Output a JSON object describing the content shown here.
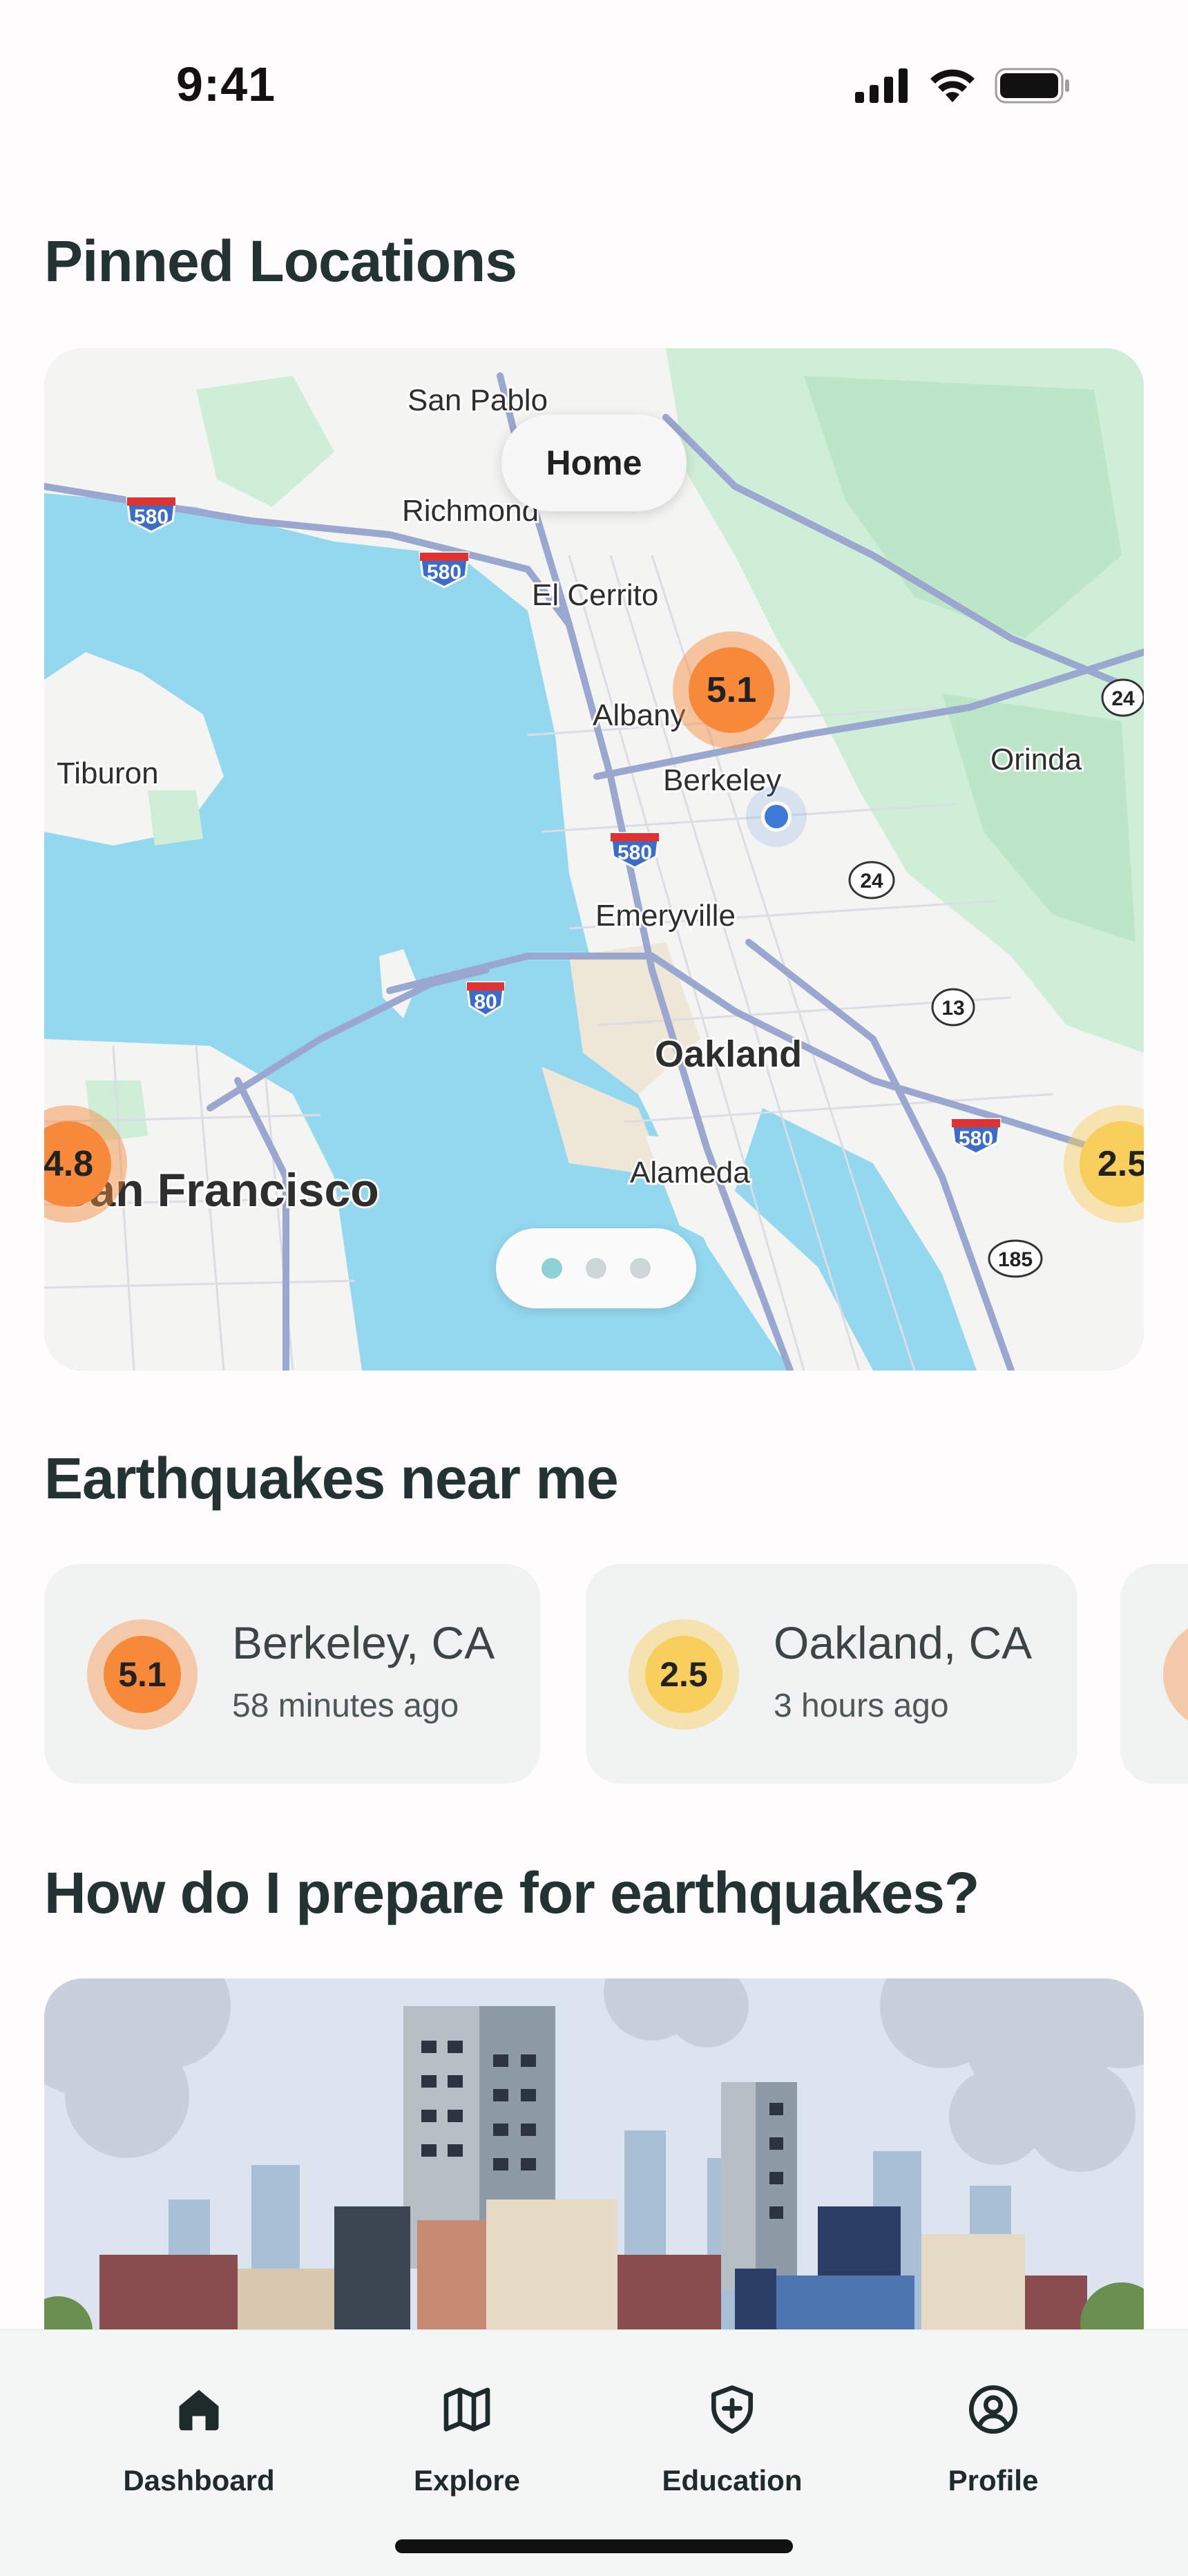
{
  "status_bar": {
    "time": "9:41"
  },
  "pinned": {
    "title": "Pinned Locations",
    "home_label": "Home",
    "map_labels": {
      "san_pablo": "San Pablo",
      "richmond": "Richmond",
      "el_cerrito": "El Cerrito",
      "albany": "Albany",
      "berkeley": "Berkeley",
      "tiburon": "Tiburon",
      "orinda": "Orinda",
      "emeryville": "Emeryville",
      "oakland": "Oakland",
      "alameda": "Alameda",
      "san_francisco": "San Francisco"
    },
    "route_shields": [
      "580",
      "580",
      "580",
      "580",
      "80",
      "24",
      "24",
      "13",
      "185"
    ],
    "map_quakes": [
      {
        "magnitude": "5.1",
        "color": "#f7893a"
      },
      {
        "magnitude": "4.8",
        "color": "#f7893a"
      },
      {
        "magnitude": "2.5",
        "color": "#f8cf5d"
      }
    ],
    "pager": {
      "count": 3,
      "active": 0
    }
  },
  "nearby": {
    "title": "Earthquakes near me",
    "items": [
      {
        "magnitude": "5.1",
        "place": "Berkeley, CA",
        "ago": "58 minutes ago",
        "color": "#f7893a"
      },
      {
        "magnitude": "2.5",
        "place": "Oakland, CA",
        "ago": "3 hours ago",
        "color": "#f8cf5d"
      }
    ]
  },
  "prepare": {
    "title": "How do I prepare for earthquakes?"
  },
  "tabs": [
    {
      "label": "Dashboard",
      "icon": "home-icon"
    },
    {
      "label": "Explore",
      "icon": "map-icon"
    },
    {
      "label": "Education",
      "icon": "shield-plus-icon"
    },
    {
      "label": "Profile",
      "icon": "profile-icon"
    }
  ]
}
